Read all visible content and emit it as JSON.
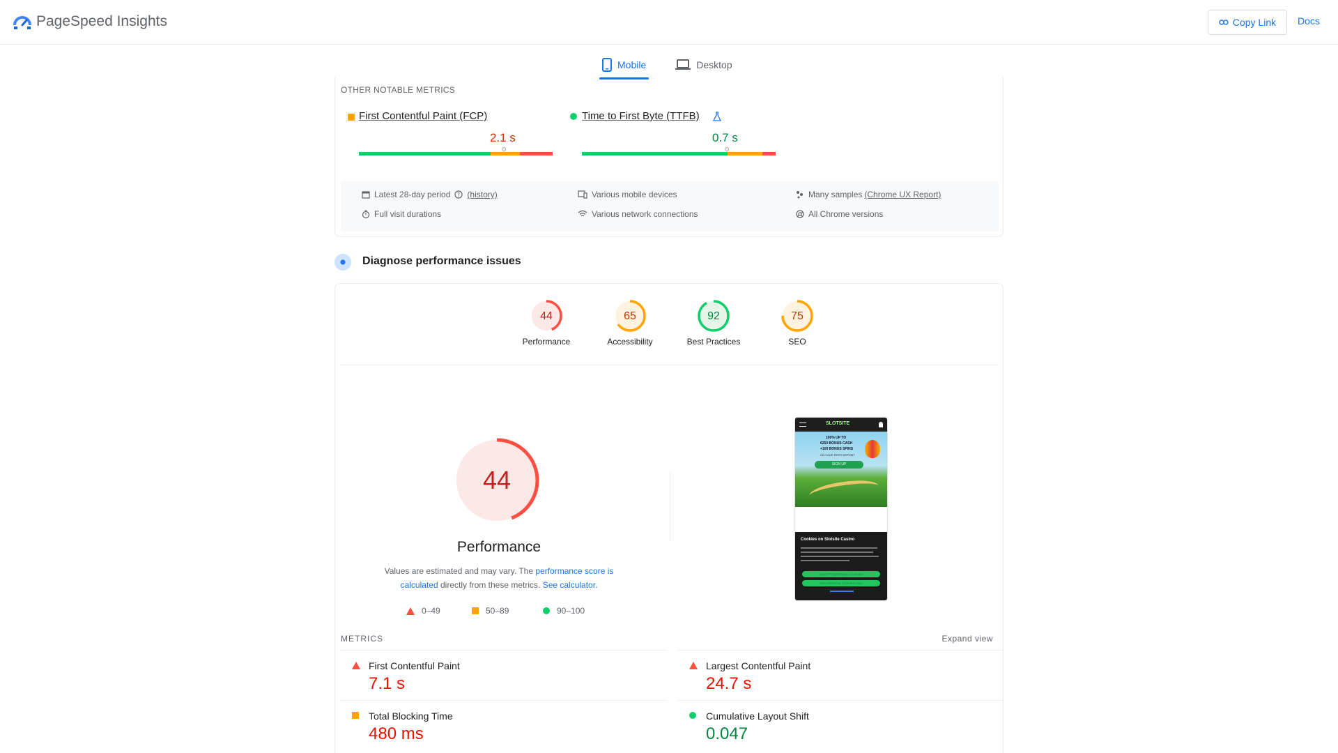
{
  "header": {
    "brand": "PageSpeed Insights",
    "copy_link_label": "Copy Link",
    "docs_label": "Docs",
    "accent_color": "#1a73e8"
  },
  "tabs": [
    {
      "label": "Mobile",
      "active": true,
      "icon": "smartphone-icon"
    },
    {
      "label": "Desktop",
      "active": false,
      "icon": "laptop-icon"
    }
  ],
  "other_metrics": {
    "heading": "OTHER NOTABLE METRICS",
    "items": [
      {
        "name": "First Contentful Paint (FCP)",
        "value": "2.1 s",
        "status": "average",
        "distribution": {
          "good": 0.68,
          "average": 0.15,
          "poor": 0.17
        },
        "marker": 0.75
      },
      {
        "name": "Time to First Byte (TTFB)",
        "value": "0.7 s",
        "status": "good",
        "distribution": {
          "good": 0.75,
          "average": 0.18,
          "poor": 0.07
        },
        "marker": 0.75
      }
    ],
    "meta": {
      "period": "Latest 28-day period",
      "history": "(history)",
      "devices": "Various mobile devices",
      "samples_prefix": "Many samples",
      "samples_link": "(Chrome UX Report)",
      "durations": "Full visit durations",
      "network": "Various network connections",
      "chrome": "All Chrome versions"
    }
  },
  "diagnose": {
    "title": "Diagnose performance issues"
  },
  "scores": [
    {
      "label": "Performance",
      "value": "44",
      "score": 44,
      "color": "#ff4e42"
    },
    {
      "label": "Accessibility",
      "value": "65",
      "score": 65,
      "color": "#ffa400"
    },
    {
      "label": "Best Practices",
      "value": "92",
      "score": 92,
      "color": "#0cce6b"
    },
    {
      "label": "SEO",
      "value": "75",
      "score": 75,
      "color": "#ffa400"
    }
  ],
  "performance": {
    "score": "44",
    "title": "Performance",
    "note_1": "Values are estimated and may vary. The ",
    "note_link_1": "performance score is calculated",
    "note_2": " directly from these metrics. ",
    "note_link_2": "See calculator.",
    "legend": [
      "0–49",
      "50–89",
      "90–100"
    ]
  },
  "metrics": {
    "heading": "METRICS",
    "expand": "Expand view",
    "items": [
      {
        "name": "First Contentful Paint",
        "value": "7.1 s",
        "status": "poor"
      },
      {
        "name": "Largest Contentful Paint",
        "value": "24.7 s",
        "status": "poor"
      },
      {
        "name": "Total Blocking Time",
        "value": "480 ms",
        "status": "average"
      },
      {
        "name": "Cumulative Layout Shift",
        "value": "0.047",
        "status": "good"
      }
    ]
  },
  "screenshot": {
    "site_brand": "SLOTSITE",
    "promo_1": "100% UP TO",
    "promo_2": "€250 BONUS CASH",
    "promo_3": "+100 BONUS SPINS",
    "promo_4": "ON YOUR FIRST DEPOSIT",
    "signup": "SIGN UP",
    "cookie_title": "Cookies on Slotsite Casino",
    "cookie_btn_1": "I ACCEPT ADDITIONAL COOKIES",
    "cookie_btn_2": "USE ESSENTIAL COOKIES ONLY"
  }
}
